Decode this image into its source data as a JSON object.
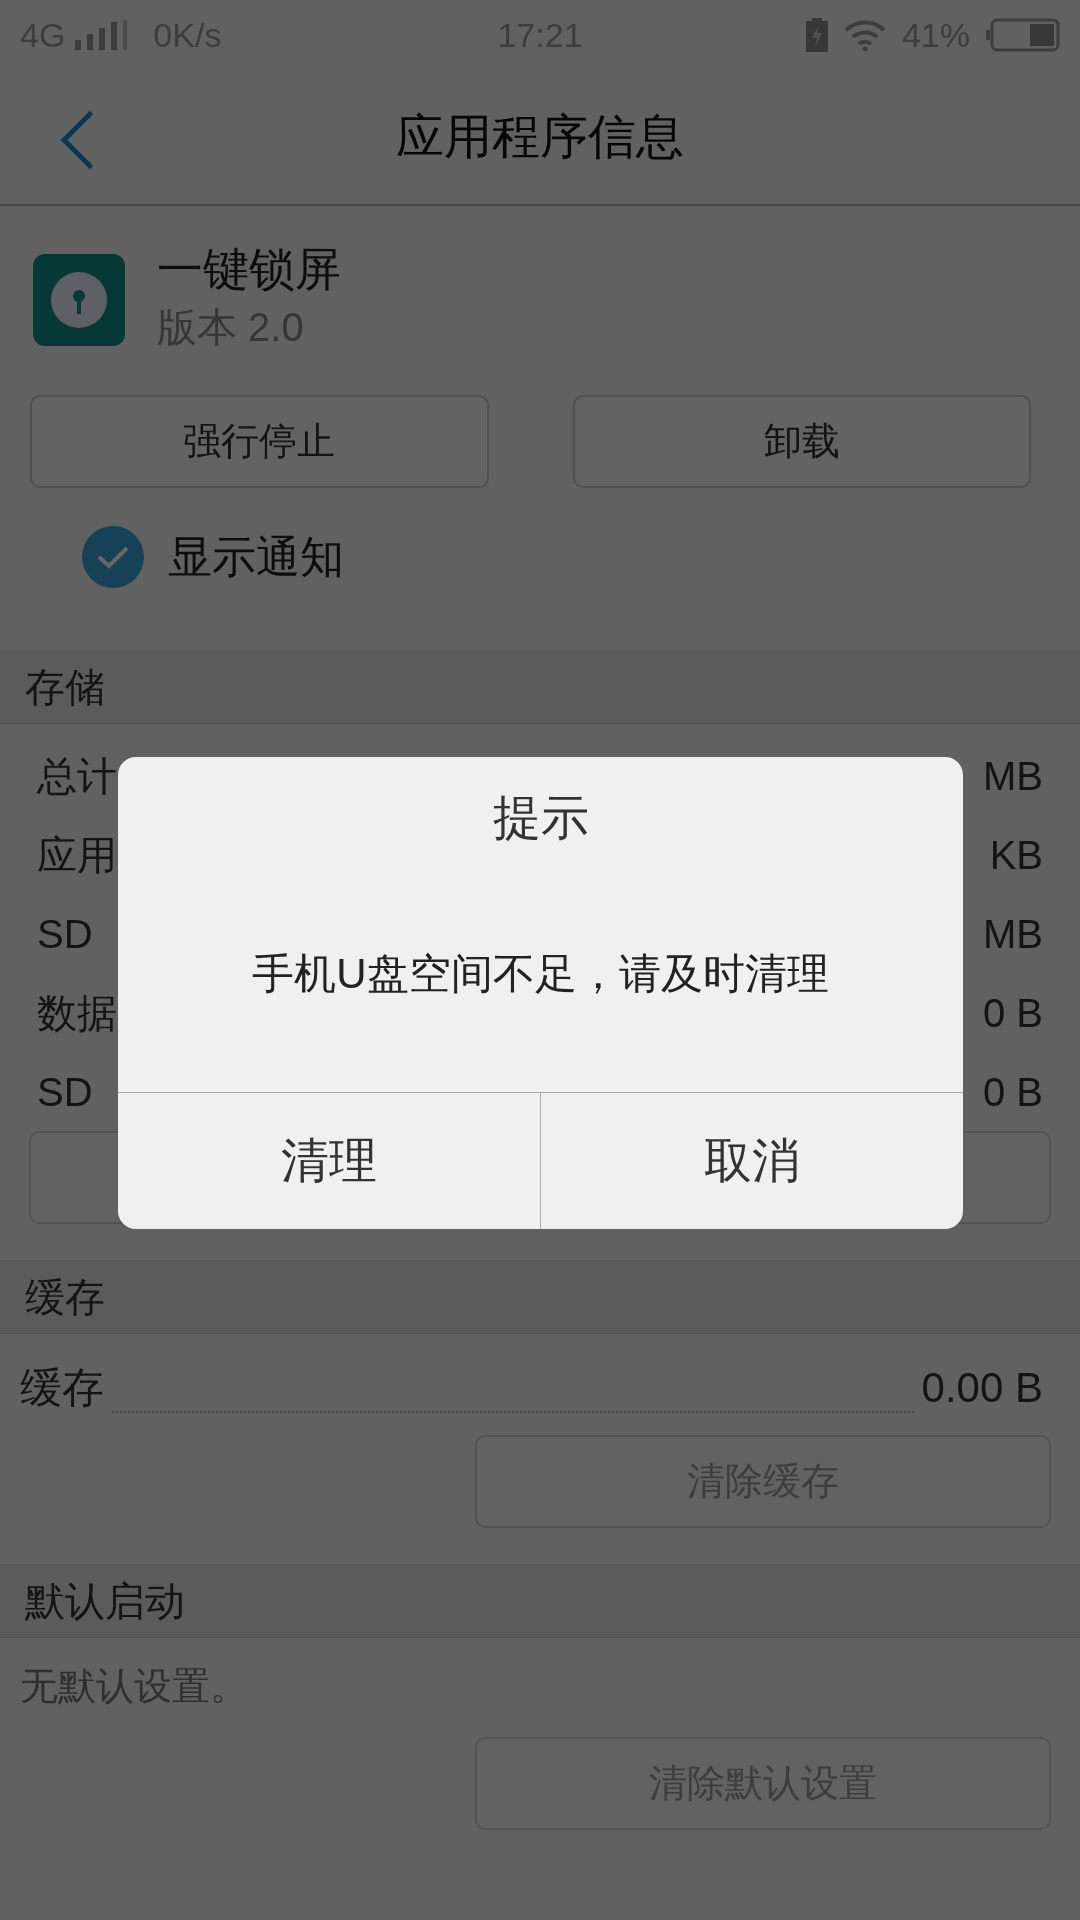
{
  "status_bar": {
    "network": "4G",
    "speed": "0K/s",
    "time": "17:21",
    "battery": "41%"
  },
  "title_bar": {
    "title": "应用程序信息"
  },
  "app": {
    "name": "一键锁屏",
    "version": "版本 2.0"
  },
  "actions": [
    "强行停止",
    "卸载"
  ],
  "notification": {
    "label": "显示通知",
    "checked": true
  },
  "sections": [
    {
      "kind": "storage",
      "header": "存储",
      "rows": [
        {
          "label": "总计",
          "value": "MB"
        },
        {
          "label": "应用",
          "value": "KB"
        },
        {
          "label": "SD",
          "value": "MB"
        },
        {
          "label": "数据",
          "value": "0 B"
        },
        {
          "label": "SD",
          "value": "0 B"
        }
      ]
    },
    {
      "kind": "cache",
      "header": "缓存",
      "rows": [
        {
          "label": "缓存",
          "value": "0.00 B"
        }
      ],
      "button": "清除缓存"
    },
    {
      "kind": "default",
      "header": "默认启动",
      "note": "无默认设置。",
      "button": "清除默认设置"
    }
  ],
  "dialog": {
    "title": "提示",
    "message": "手机U盘空间不足，请及时清理",
    "buttons": [
      "清理",
      "取消"
    ]
  }
}
